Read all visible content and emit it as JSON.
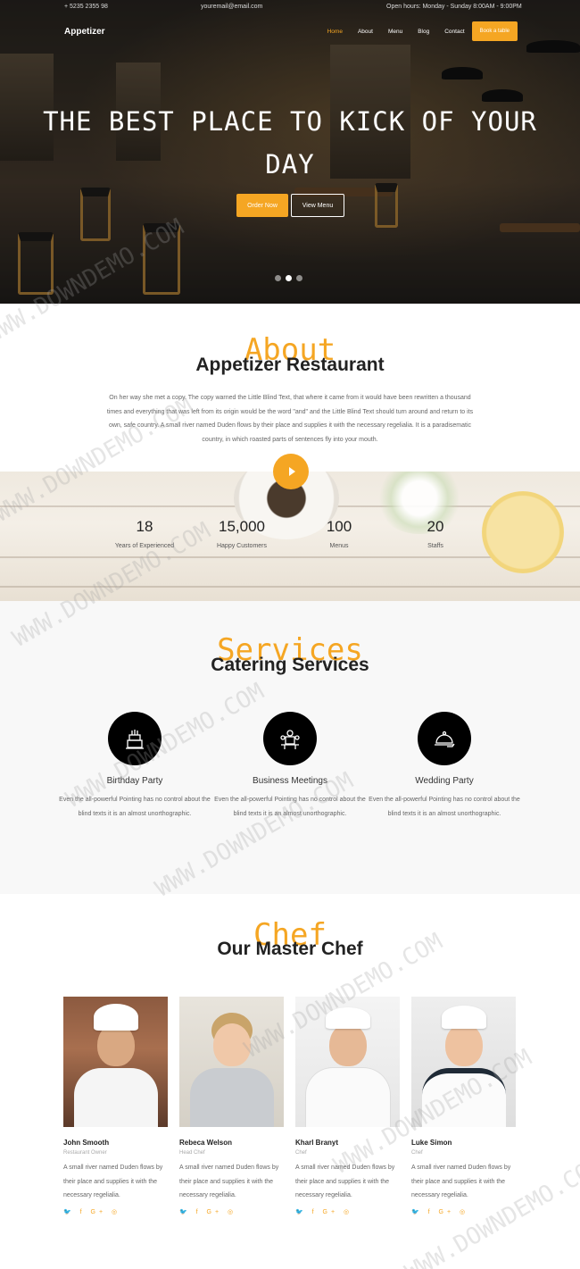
{
  "topbar": {
    "phone": "+ 5235 2355 98",
    "email": "youremail@email.com",
    "hours": "Open hours: Monday - Sunday 8:00AM - 9:00PM"
  },
  "nav": {
    "brand": "Appetizer",
    "items": [
      "Home",
      "About",
      "Menu",
      "Blog",
      "Contact"
    ],
    "book": "Book a table"
  },
  "hero": {
    "title": "THE BEST PLACE TO KICK OF YOUR DAY",
    "order_btn": "Order Now",
    "menu_btn": "View Menu"
  },
  "about": {
    "bg_word": "About",
    "title": "Appetizer Restaurant",
    "text": "On her way she met a copy. The copy warned the Little Blind Text, that where it came from it would have been rewritten a thousand times and everything that was left from its origin would be the word \"and\" and the Little Blind Text should turn around and return to its own, safe country. A small river named Duden flows by their place and supplies it with the necessary regelialia. It is a paradisematic country, in which roasted parts of sentences fly into your mouth."
  },
  "stats": [
    {
      "num": "18",
      "label": "Years of Experienced"
    },
    {
      "num": "15,000",
      "label": "Happy Customers"
    },
    {
      "num": "100",
      "label": "Menus"
    },
    {
      "num": "20",
      "label": "Staffs"
    }
  ],
  "services": {
    "bg_word": "Services",
    "title": "Catering Services",
    "items": [
      {
        "name": "Birthday Party",
        "desc": "Even the all-powerful Pointing has no control about the blind texts it is an almost unorthographic."
      },
      {
        "name": "Business Meetings",
        "desc": "Even the all-powerful Pointing has no control about the blind texts it is an almost unorthographic."
      },
      {
        "name": "Wedding Party",
        "desc": "Even the all-powerful Pointing has no control about the blind texts it is an almost unorthographic."
      }
    ]
  },
  "chefs": {
    "bg_word": "Chef",
    "title": "Our Master Chef",
    "items": [
      {
        "name": "John Smooth",
        "role": "Restaurant Owner",
        "desc": "A small river named Duden flows by their place and supplies it with the necessary regelialia.",
        "social": "🐦 f G+ ◎"
      },
      {
        "name": "Rebeca Welson",
        "role": "Head Chef",
        "desc": "A small river named Duden flows by their place and supplies it with the necessary regelialia.",
        "social": "🐦 f G+ ◎"
      },
      {
        "name": "Kharl Branyt",
        "role": "Chef",
        "desc": "A small river named Duden flows by their place and supplies it with the necessary regelialia.",
        "social": "🐦 f G+ ◎"
      },
      {
        "name": "Luke Simon",
        "role": "Chef",
        "desc": "A small river named Duden flows by their place and supplies it with the necessary regelialia.",
        "social": "🐦 f G+ ◎"
      }
    ]
  },
  "watermark": "WWW.DOWNDEMO.COM",
  "colors": {
    "accent": "#f5a623",
    "dark": "#000000"
  }
}
